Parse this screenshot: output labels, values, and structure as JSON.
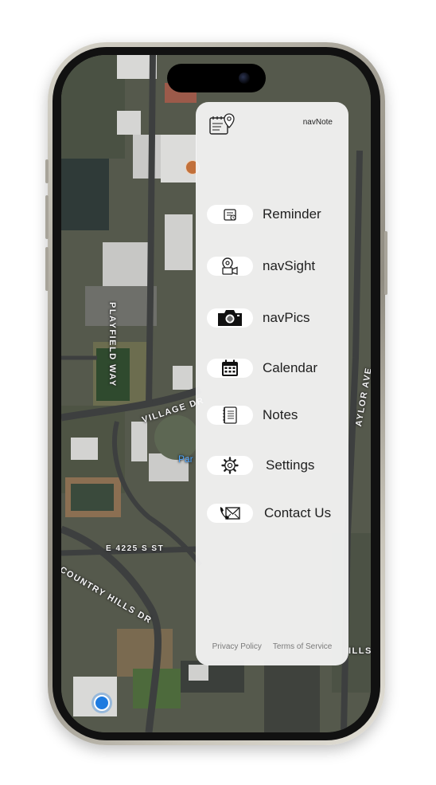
{
  "app": {
    "brand_name": "navNote",
    "brand_icon": "map-note-icon"
  },
  "menu": {
    "items": [
      {
        "label": "Reminder",
        "icon": "reminder-icon"
      },
      {
        "label": "navSight",
        "icon": "navsight-icon"
      },
      {
        "label": "navPics",
        "icon": "camera-icon"
      },
      {
        "label": "Calendar",
        "icon": "calendar-icon"
      },
      {
        "label": "Notes",
        "icon": "notes-icon"
      },
      {
        "label": "Settings",
        "icon": "gear-icon"
      },
      {
        "label": "Contact Us",
        "icon": "contact-icon"
      }
    ]
  },
  "footer": {
    "privacy": "Privacy Policy",
    "terms": "Terms of Service"
  },
  "map": {
    "streets": {
      "playfield": "PLAYFIELD WAY",
      "village": "VILLAGE DR",
      "country_hills": "COUNTRY HILLS DR",
      "e4225": "E 4225 S ST",
      "taylor": "AYLOR AVE",
      "hills_d": "ILLS D",
      "park": "Par"
    }
  },
  "colors": {
    "drawer_bg": "#f7f7f7",
    "pill_bg": "#ffffff",
    "location_blue": "#1e7be0"
  }
}
